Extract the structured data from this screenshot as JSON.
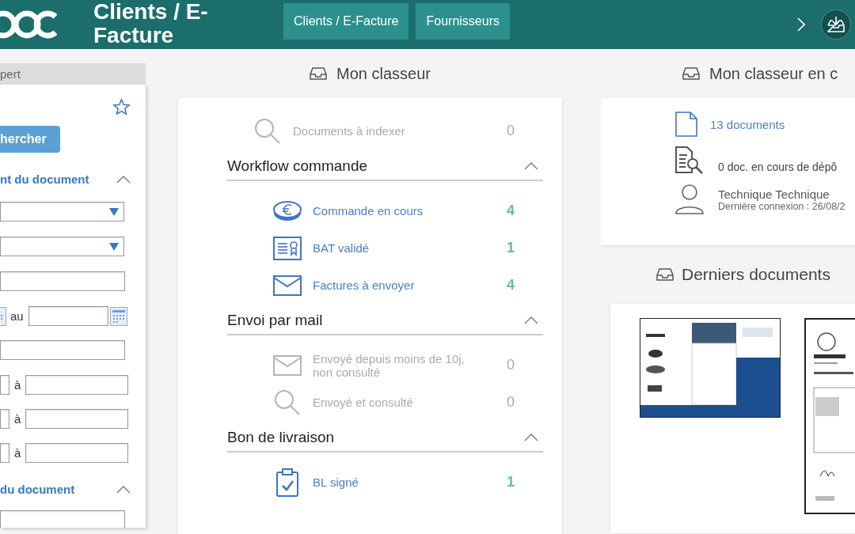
{
  "header": {
    "title": "Clients / E-Facture",
    "nav_tabs": [
      {
        "label": "Clients / E-Facture"
      },
      {
        "label": "Fournisseurs"
      }
    ]
  },
  "sidebar": {
    "tab_label": "pert",
    "search_button": "hercher",
    "controls": [
      {
        "kind": "section",
        "title": "nt du document",
        "expanded": true
      },
      {
        "kind": "select"
      },
      {
        "kind": "select"
      },
      {
        "kind": "text"
      },
      {
        "kind": "date_range",
        "separator": "au"
      },
      {
        "kind": "text"
      },
      {
        "kind": "range",
        "separator": "à"
      },
      {
        "kind": "range",
        "separator": "à"
      },
      {
        "kind": "range",
        "separator": "à"
      },
      {
        "kind": "section",
        "title": "du document",
        "expanded": true
      }
    ]
  },
  "classeur": {
    "title": "Mon classeur",
    "top_item": {
      "kind": "search",
      "label": "Documents à indexer",
      "count": "0",
      "disabled": true
    },
    "groups": [
      {
        "title": "Workflow commande",
        "expanded": true,
        "items": [
          {
            "kind": "euro",
            "label": "Commande en cours",
            "count": "4",
            "disabled": false
          },
          {
            "kind": "certificate",
            "label": "BAT validé",
            "count": "1",
            "disabled": false
          },
          {
            "kind": "mail",
            "label": "Factures à envoyer",
            "count": "4",
            "disabled": false
          }
        ]
      },
      {
        "title": "Envoi par mail",
        "expanded": true,
        "items": [
          {
            "kind": "mail",
            "label": "Envoyé depuis moins de 10j, non consulté",
            "count": "0",
            "disabled": true
          },
          {
            "kind": "search",
            "label": "Envoyé et consulté",
            "count": "0",
            "disabled": true
          }
        ]
      },
      {
        "title": "Bon de livraison",
        "expanded": true,
        "items": [
          {
            "kind": "clipboard",
            "label": "BL signé",
            "count": "1",
            "disabled": false
          }
        ]
      }
    ]
  },
  "classeur_en_cours": {
    "title": "Mon classeur en c",
    "documents_link": "13 documents",
    "pending": "0 doc. en cours de dépô",
    "user_name": "Technique Technique",
    "last_login": "Dernière connexion : 26/08/2"
  },
  "derniers_documents": {
    "title": "Derniers documents"
  }
}
